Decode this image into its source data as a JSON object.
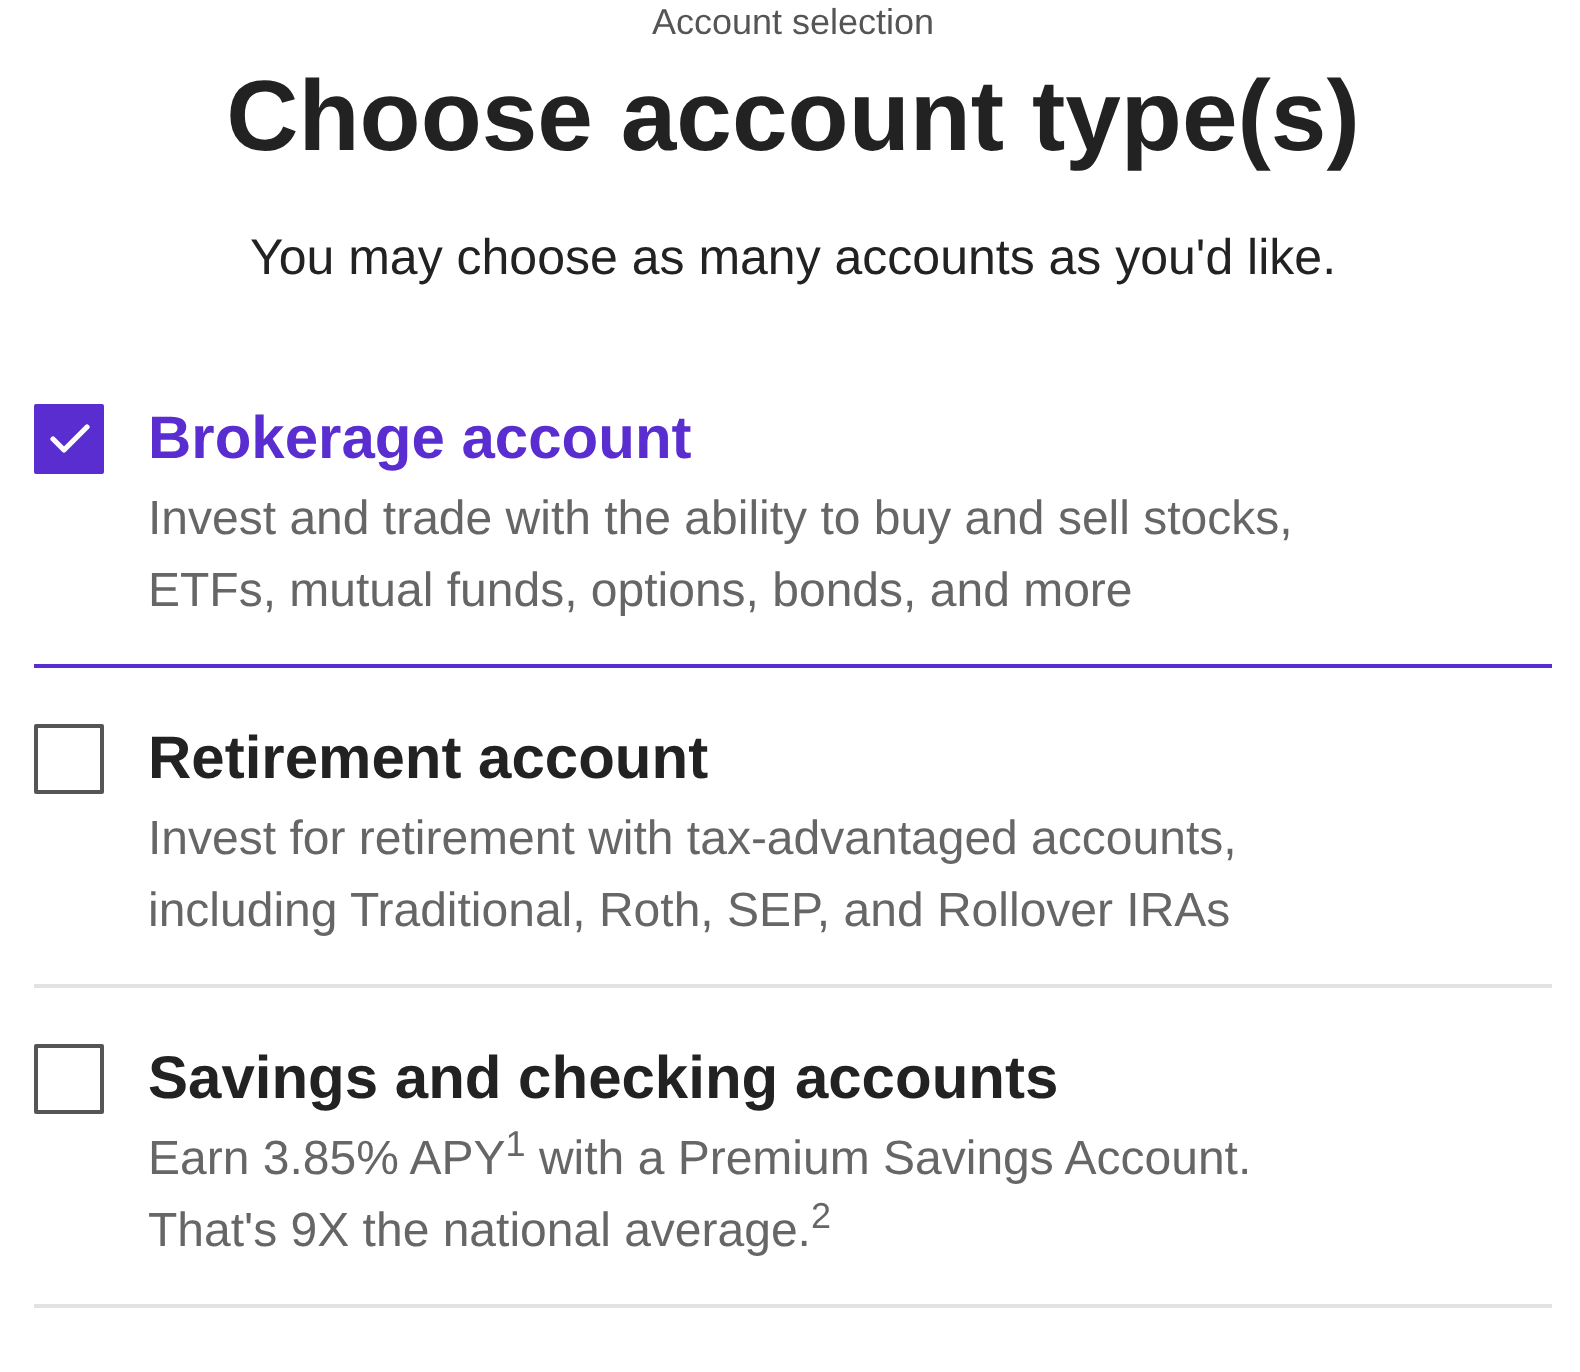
{
  "header": {
    "eyebrow": "Account selection",
    "title": "Choose account type(s)",
    "subtitle": "You may choose as many accounts as you'd like."
  },
  "account_options": [
    {
      "title": "Brokerage account",
      "description": "Invest and trade with the ability to buy and sell stocks, ETFs, mutual funds, options, bonds, and more",
      "checked": true
    },
    {
      "title": "Retirement account",
      "description": "Invest for retirement with tax-advantaged accounts, including Traditional, Roth, SEP, and Rollover IRAs",
      "checked": false
    },
    {
      "title": "Savings and checking accounts",
      "description": "Earn 3.85% APY$^{1}$ with a Premium Savings Account. That's 9X the national average.$^{2}$",
      "checked": false
    }
  ]
}
